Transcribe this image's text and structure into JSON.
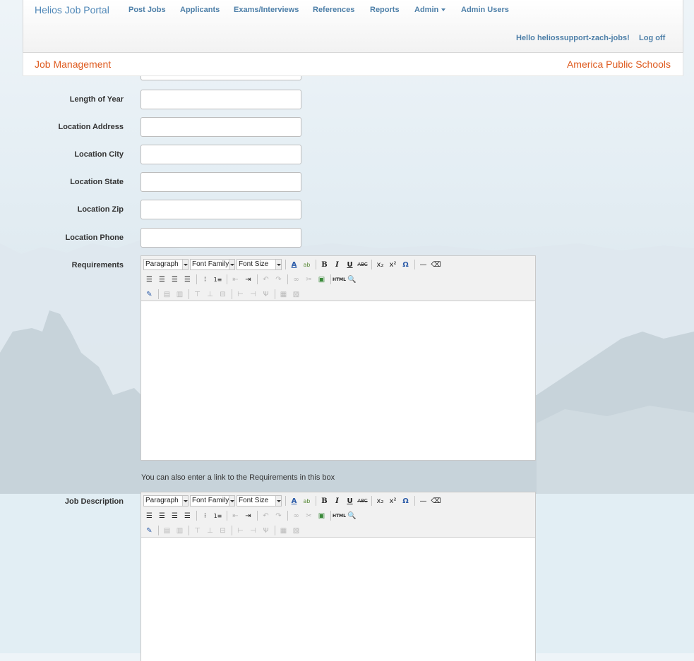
{
  "navbar": {
    "brand": "Helios Job Portal",
    "items": [
      {
        "label": "Post Jobs"
      },
      {
        "label": "Applicants"
      },
      {
        "label": "Exams/Interviews"
      },
      {
        "label": "References"
      },
      {
        "label": "Reports"
      },
      {
        "label": "Admin"
      },
      {
        "label": "Admin Users"
      }
    ],
    "greeting": "Hello heliossupport-zach-jobs!",
    "logoff": "Log off"
  },
  "subbar": {
    "title": "Job Management",
    "organization": "America Public Schools"
  },
  "fields": [
    {
      "label": "Length of Year",
      "value": ""
    },
    {
      "label": "Location Address",
      "value": ""
    },
    {
      "label": "Location City",
      "value": ""
    },
    {
      "label": "Location State",
      "value": ""
    },
    {
      "label": "Location Zip",
      "value": ""
    },
    {
      "label": "Location Phone",
      "value": ""
    }
  ],
  "requirements": {
    "label": "Requirements",
    "hint": "You can also enter a link to the Requirements in this box"
  },
  "job_description": {
    "label": "Job Description"
  },
  "editor_toolbar": {
    "format": "Paragraph",
    "font_family": "Font Family",
    "font_size": "Font Size",
    "row1_buttons": [
      "font-color-icon",
      "highlight-color-icon",
      "bold-icon",
      "italic-icon",
      "underline-icon",
      "strikethrough-icon",
      "subscript-icon",
      "superscript-icon",
      "special-char-icon",
      "horizontal-rule-icon",
      "eraser-icon"
    ],
    "row2_buttons": [
      "align-left-icon",
      "align-center-icon",
      "align-right-icon",
      "align-justify-icon",
      "bullet-list-icon",
      "numbered-list-icon",
      "outdent-icon",
      "indent-icon",
      "undo-icon",
      "redo-icon",
      "link-icon",
      "unlink-icon",
      "image-icon",
      "html-source-icon",
      "preview-icon"
    ],
    "row3_buttons": [
      "edit-icon",
      "table-icon",
      "cell-props-icon",
      "insert-row-before-icon",
      "insert-row-after-icon",
      "delete-row-icon",
      "insert-col-before-icon",
      "insert-col-after-icon",
      "delete-col-icon",
      "split-cells-icon",
      "merge-cells-icon"
    ]
  },
  "colors": {
    "accent_blue": "#4d7fa8",
    "accent_orange": "#de5a1e"
  }
}
